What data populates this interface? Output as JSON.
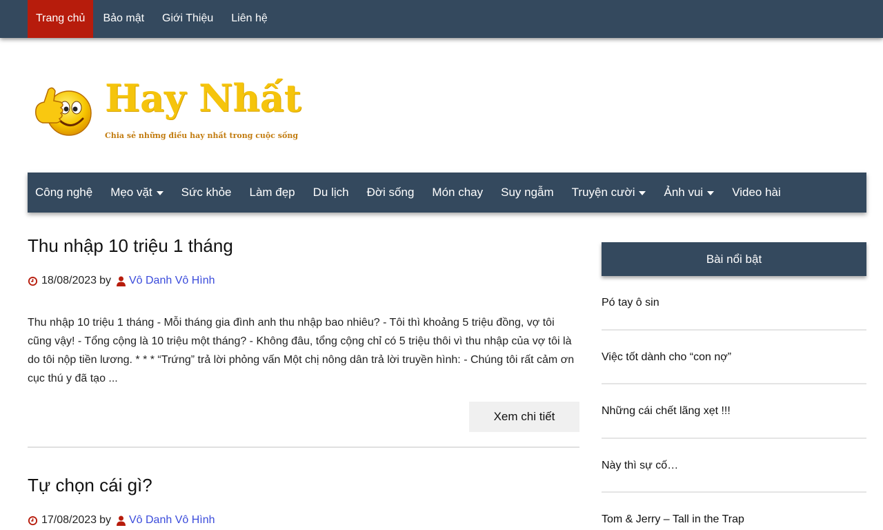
{
  "top_nav": [
    {
      "label": "Trang chủ",
      "active": true
    },
    {
      "label": "Bảo mật",
      "active": false
    },
    {
      "label": "Giới Thiệu",
      "active": false
    },
    {
      "label": "Liên hệ",
      "active": false
    }
  ],
  "logo": {
    "title": "Hay Nhất",
    "tagline": "Chia sẻ những điều hay nhất trong cuộc sống"
  },
  "main_nav": [
    {
      "label": "Công nghệ",
      "dropdown": false
    },
    {
      "label": "Mẹo vặt",
      "dropdown": true
    },
    {
      "label": "Sức khỏe",
      "dropdown": false
    },
    {
      "label": "Làm đẹp",
      "dropdown": false
    },
    {
      "label": "Du lịch",
      "dropdown": false
    },
    {
      "label": "Đời sống",
      "dropdown": false
    },
    {
      "label": "Món chay",
      "dropdown": false
    },
    {
      "label": "Suy ngẫm",
      "dropdown": false
    },
    {
      "label": "Truyện cười",
      "dropdown": true
    },
    {
      "label": "Ảnh vui",
      "dropdown": true
    },
    {
      "label": "Video hài",
      "dropdown": false
    }
  ],
  "articles": [
    {
      "title": "Thu nhập 10 triệu 1 tháng",
      "date": "18/08/2023",
      "by": "by",
      "author": "Vô Danh Vô Hình",
      "excerpt": "Thu nhập 10 triệu 1 tháng - Mỗi tháng gia đình anh thu nhập bao nhiêu? - Tôi thì khoảng 5 triệu đồng, vợ tôi cũng vậy! - Tổng cộng là 10 triệu một tháng? - Không đâu, tổng cộng chỉ có 5 triệu thôi vì thu nhập của vợ tôi là do tôi nộp tiền lương. * * * “Trứng” trả lời phỏng vấn Một chị nông dân trả lời truyền hình: - Chúng tôi rất cảm ơn cục thú y đã tạo ...",
      "read_more": "Xem chi tiết"
    },
    {
      "title": "Tự chọn cái gì?",
      "date": "17/08/2023",
      "by": "by",
      "author": "Vô Danh Vô Hình"
    }
  ],
  "sidebar": {
    "title": "Bài nổi bật",
    "items": [
      "Pó tay ô sin",
      "Việc tốt dành cho “con nợ”",
      "Những cái chết lãng xẹt !!!",
      "Này thì sự cố…",
      "Tom & Jerry – Tall in the Trap"
    ]
  },
  "colors": {
    "nav_bg": "#34495e",
    "active_bg": "#b71c0c",
    "author_link": "#3a4bdb",
    "meta_icon": "#b71c0c",
    "logo_gold": "#f5c40c"
  },
  "icons": {
    "date": "clock-icon",
    "author": "user-icon",
    "dropdown": "caret-down-icon",
    "logo": "thumbs-up-smiley-icon"
  }
}
